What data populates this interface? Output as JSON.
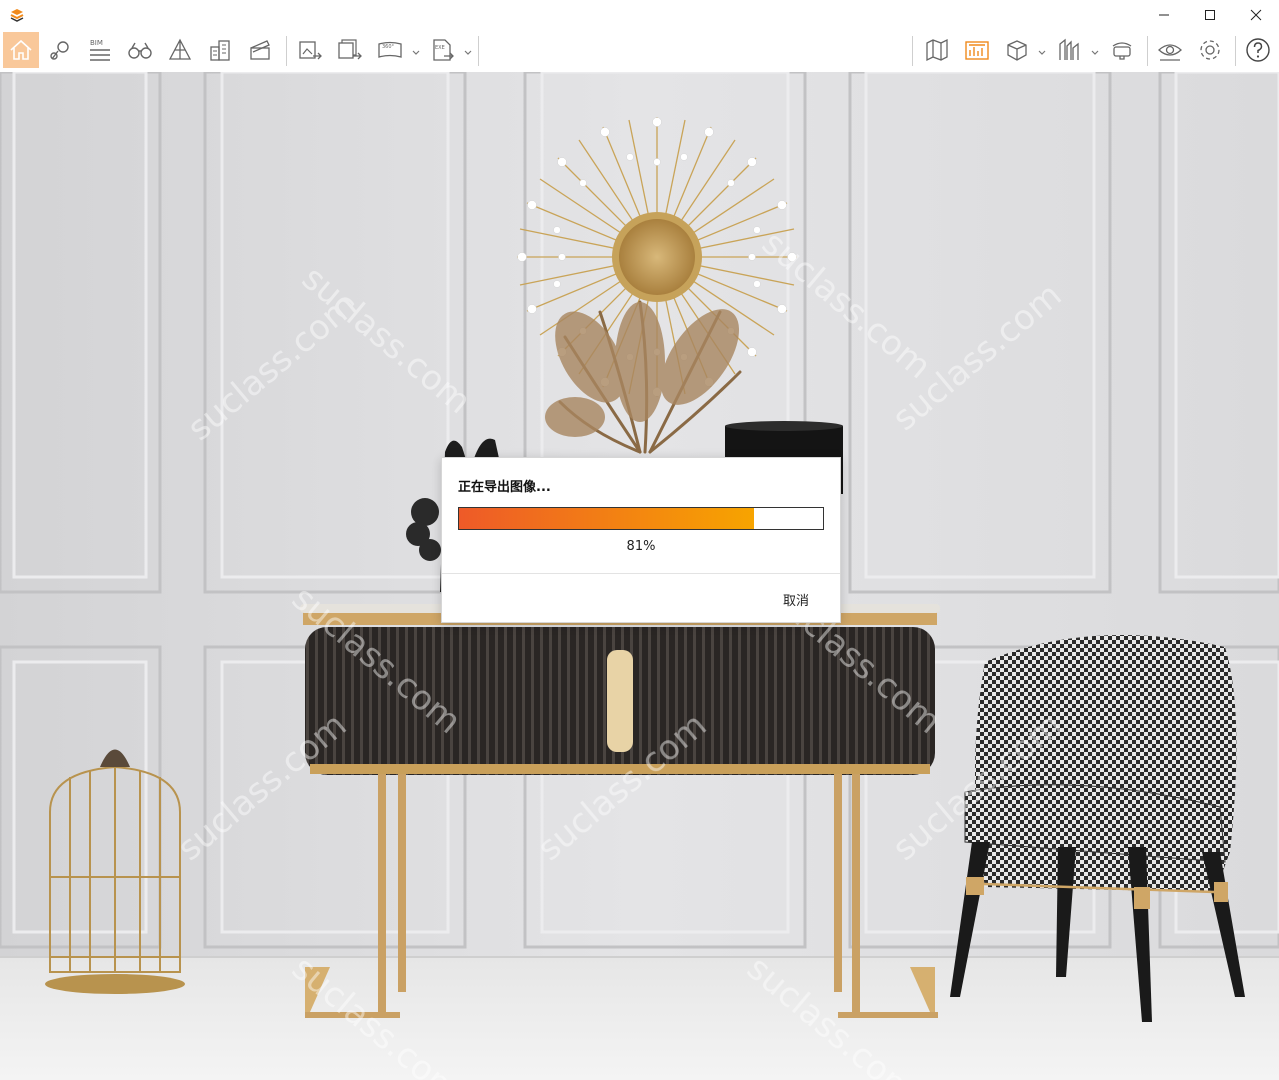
{
  "window": {
    "controls": [
      "minimize-icon",
      "maximize-icon",
      "close-icon"
    ]
  },
  "toolbar": {
    "left_tools": [
      "home-icon",
      "location-icon",
      "bim-icon",
      "binoculars-icon",
      "triangle-icon",
      "buildings-icon",
      "clapperboard-icon",
      "image-export-icon",
      "batch-export-icon",
      "panorama-360-icon",
      "exe-export-icon"
    ],
    "right_tools": [
      "map-icon",
      "chart-icon",
      "cube-icon",
      "skyline-icon",
      "vr-headset-icon",
      "eye-icon",
      "gear-icon",
      "help-icon"
    ],
    "bim_label": "BIM",
    "pano_label": "360°",
    "exe_label": "EXE",
    "accent_color": "#f08a1c"
  },
  "viewport": {
    "watermark": "suclass.com"
  },
  "export_dialog": {
    "title": "正在导出图像...",
    "progress_percent": 81,
    "progress_text": "81%",
    "cancel_label": "取消"
  }
}
